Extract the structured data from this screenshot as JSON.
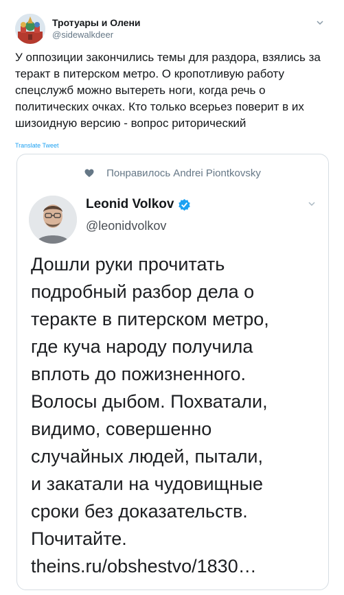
{
  "author": {
    "name": "Тротуары и Олени",
    "handle": "@sidewalkdeer"
  },
  "tweet": {
    "text": "У оппозиции закончились темы для раздора, взялись за теракт в питерском метро. О кропотливую работу спецслужб можно вытереть ноги, когда речь о политических очках. Кто только всерьез поверит в их шизоидную версию - вопрос риторический",
    "translate_label": "Translate Tweet"
  },
  "quoted": {
    "liked_by": "Понравилось Andrei Piontkovsky",
    "name": "Leonid Volkov",
    "handle": "@leonidvolkov",
    "text": "Дошли руки прочитать\nподробный разбор дела о\nтеракте в питерском метро,\nгде куча народу получила\nвплоть до пожизненного.\nВолосы дыбом. Похватали,\nвидимо, совершенно\nслучайных людей, пытали,\nи закатали на чудовищные\nсроки без доказательств.\nПочитайте.\ntheins.ru/obshestvo/1830…"
  },
  "icons": {
    "caret": "chevron-down-icon",
    "heart": "heart-icon",
    "verified": "verified-badge-icon"
  },
  "colors": {
    "link": "#1da1f2",
    "verified": "#1da1f2",
    "muted": "#657786"
  }
}
